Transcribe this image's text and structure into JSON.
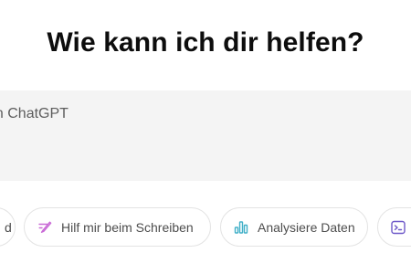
{
  "main": {
    "headline": "Wie kann ich dir helfen?"
  },
  "composer": {
    "placeholder": "an ChatGPT"
  },
  "suggestions": [
    {
      "label": "d",
      "icon": "unknown-icon"
    },
    {
      "label": "Hilf mir beim Schreiben",
      "icon": "pen-icon",
      "color": "#c96ad6"
    },
    {
      "label": "Analysiere Daten",
      "icon": "bar-chart-icon",
      "color": "#42b0c8"
    },
    {
      "label": "",
      "icon": "terminal-icon",
      "color": "#6e59c9"
    }
  ]
}
